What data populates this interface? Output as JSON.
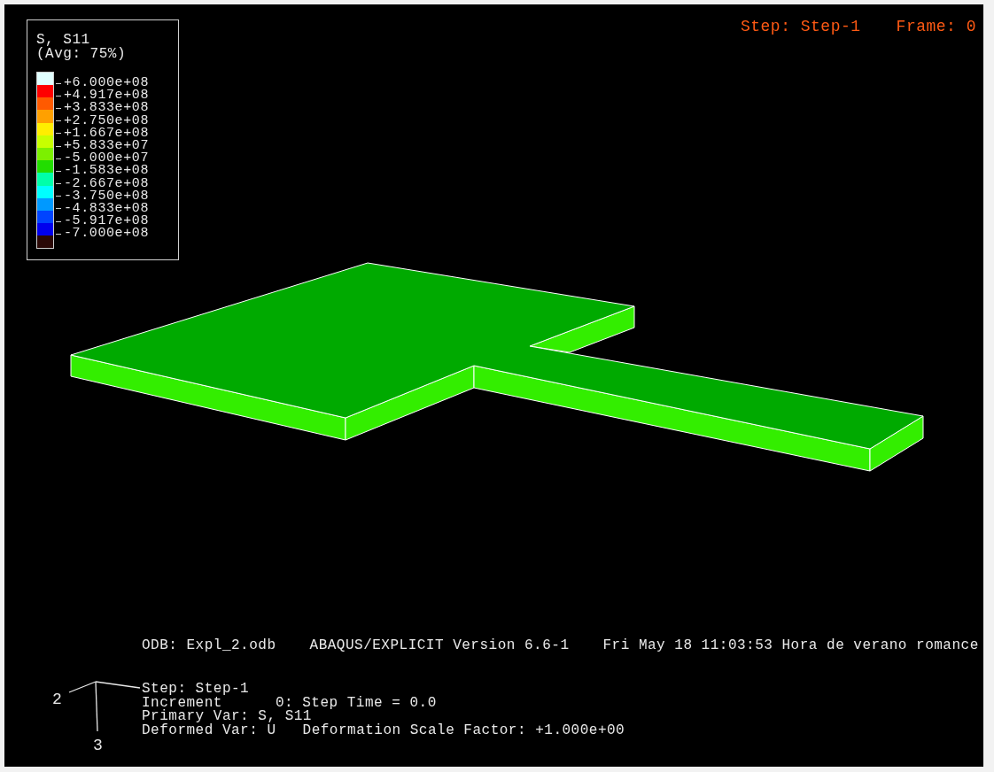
{
  "legend": {
    "title": "S, S11",
    "subtitle": "(Avg: 75%)",
    "labels": [
      "+6.000e+08",
      "+4.917e+08",
      "+3.833e+08",
      "+2.750e+08",
      "+1.667e+08",
      "+5.833e+07",
      "-5.000e+07",
      "-1.583e+08",
      "-2.667e+08",
      "-3.750e+08",
      "-4.833e+08",
      "-5.917e+08",
      "-7.000e+08"
    ],
    "bands": [
      {
        "color": "#e0ffff"
      },
      {
        "color": "#ff0000"
      },
      {
        "color": "#ff5a00"
      },
      {
        "color": "#ffa000"
      },
      {
        "color": "#ffee00"
      },
      {
        "color": "#c8ff00"
      },
      {
        "color": "#7cf000"
      },
      {
        "color": "#22dd00"
      },
      {
        "color": "#00ffaa"
      },
      {
        "color": "#00ffff"
      },
      {
        "color": "#0099ff"
      },
      {
        "color": "#0044ff"
      },
      {
        "color": "#0000ee"
      },
      {
        "color": "#2a0806"
      }
    ]
  },
  "header": {
    "step": "Step: Step-1",
    "frame": "Frame: 0"
  },
  "odb_line": {
    "odb": "ODB: Expl_2.odb",
    "version": "ABAQUS/EXPLICIT Version 6.6-1",
    "date": "Fri May 18 11:03:53 Hora de verano romance"
  },
  "triad": {
    "axis_2": "2",
    "axis_3": "3"
  },
  "step_info": {
    "step": "Step: Step-1",
    "increment_label": "Increment",
    "increment_value": "0: Step Time = 0.0",
    "primary_var": "Primary Var: S, S11",
    "deformed_var": "Deformed Var: U",
    "scale_factor": "Deformation Scale Factor: +1.000e+00"
  }
}
